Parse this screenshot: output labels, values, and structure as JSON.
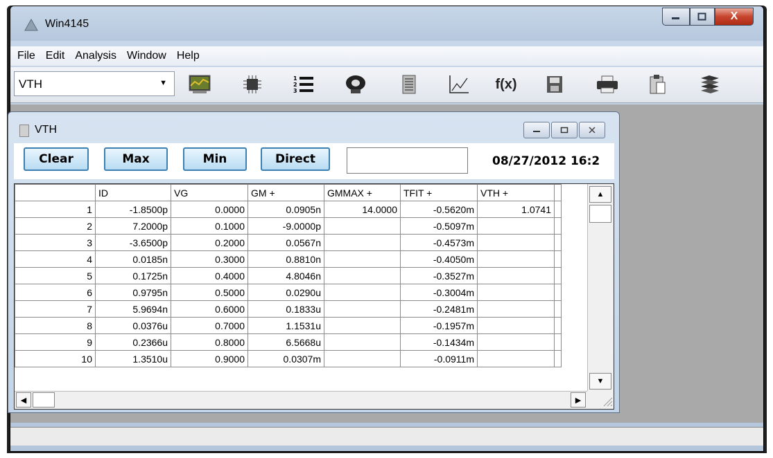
{
  "app": {
    "title": "Win4145",
    "menu": [
      "File",
      "Edit",
      "Analysis",
      "Window",
      "Help"
    ],
    "toolbar": {
      "combo_value": "VTH",
      "icons": [
        "graph-icon",
        "chip-icon",
        "numbered-list-icon",
        "probe-icon",
        "document-icon",
        "plot-icon",
        "function-icon",
        "save-icon",
        "print-icon",
        "clipboard-icon",
        "stack-icon"
      ],
      "function_label": "f(x)"
    },
    "caption": {
      "close_label": "X"
    }
  },
  "child": {
    "title": "VTH",
    "buttons": [
      "Clear",
      "Max",
      "Min",
      "Direct"
    ],
    "input_value": "",
    "datetime": "08/27/2012  16:2"
  },
  "grid": {
    "columns": [
      "ID",
      "VG",
      "GM +",
      "GMMAX +",
      "TFIT +",
      "VTH +"
    ],
    "rows": [
      [
        "1",
        "-1.8500p",
        "0.0000",
        "0.0905n",
        "14.0000",
        "-0.5620m",
        "1.0741"
      ],
      [
        "2",
        "7.2000p",
        "0.1000",
        "-9.0000p",
        "",
        "-0.5097m",
        ""
      ],
      [
        "3",
        "-3.6500p",
        "0.2000",
        "0.0567n",
        "",
        "-0.4573m",
        ""
      ],
      [
        "4",
        "0.0185n",
        "0.3000",
        "0.8810n",
        "",
        "-0.4050m",
        ""
      ],
      [
        "5",
        "0.1725n",
        "0.4000",
        "4.8046n",
        "",
        "-0.3527m",
        ""
      ],
      [
        "6",
        "0.9795n",
        "0.5000",
        "0.0290u",
        "",
        "-0.3004m",
        ""
      ],
      [
        "7",
        "5.9694n",
        "0.6000",
        "0.1833u",
        "",
        "-0.2481m",
        ""
      ],
      [
        "8",
        "0.0376u",
        "0.7000",
        "1.1531u",
        "",
        "-0.1957m",
        ""
      ],
      [
        "9",
        "0.2366u",
        "0.8000",
        "6.5668u",
        "",
        "-0.1434m",
        ""
      ],
      [
        "10",
        "1.3510u",
        "0.9000",
        "0.0307m",
        "",
        "-0.0911m",
        ""
      ]
    ]
  }
}
